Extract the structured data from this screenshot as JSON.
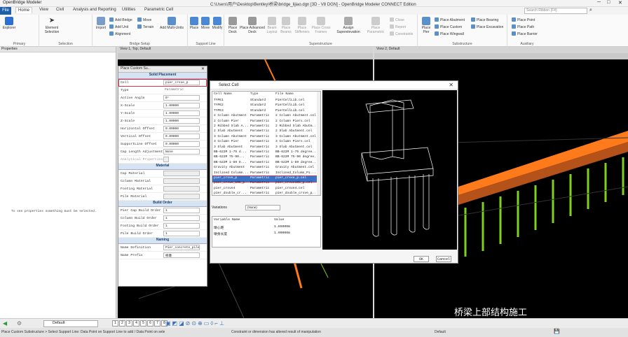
{
  "window": {
    "app_title": "OpenBridge Modeler",
    "path": "C:\\Users\\用户\\Desktop\\Bentley\\桥梁\\bridge_lijiao.dgn [3D - V8 DGN] - OpenBridge Modeler CONNECT Edition"
  },
  "tabs": [
    "File",
    "Home",
    "View",
    "Civil",
    "Analysis and Reporting",
    "Utilities",
    "Parametric Cell"
  ],
  "search_placeholder": "Search Ribbon (F4)",
  "ribbon": {
    "groups": [
      "Primary",
      "Selection",
      "Bridge Setup",
      "Support Line",
      "Superstructure",
      "Substructure",
      "Auxiliary"
    ],
    "primary": [
      "Explorer"
    ],
    "selection": [
      "Element Selection"
    ],
    "setup": [
      "Import",
      "Add Bridge",
      "Add Unit",
      "Alignment",
      "Move",
      "Terrain",
      "Add Multi-Units"
    ],
    "support": [
      "Place",
      "Move",
      "Modify"
    ],
    "super": [
      "Place Deck",
      "Place Advanced Deck",
      "Beam Layout",
      "Place Beams",
      "Place Stiffeners",
      "Place Cross Frames",
      "Assign Superelevation",
      "Place Parametric",
      "Close",
      "Report",
      "Constraints"
    ],
    "sub": [
      "Place Pier",
      "Place Abutment",
      "Place Custom",
      "Place Wingwall",
      "Place Bearing",
      "Place Excavation"
    ],
    "aux": [
      "Place Point",
      "Place Path",
      "Place Barrier"
    ]
  },
  "properties": {
    "title": "Properties",
    "message": "To see properties something must be selected."
  },
  "views": {
    "v1": "View 1, Top, Default",
    "v2": "View 2, Default"
  },
  "place_custom": {
    "title": "Place Custom Su...",
    "sections": {
      "solid": "Solid Placement",
      "material": "Material",
      "build": "Build Order",
      "naming": "Naming"
    },
    "solid_rows": [
      {
        "k": "Cell",
        "v": "pier_crsve_p"
      },
      {
        "k": "Type",
        "v": "Parametric"
      },
      {
        "k": "Active Angle",
        "v": "0°"
      },
      {
        "k": "X-Scale",
        "v": "1.00000"
      },
      {
        "k": "Y-Scale",
        "v": "1.00000"
      },
      {
        "k": "Z-Scale",
        "v": "1.00000"
      },
      {
        "k": "Horizontal Offset",
        "v": "0.00000"
      },
      {
        "k": "Vertical Offset",
        "v": "0.00000"
      },
      {
        "k": "SupportLine Offset",
        "v": "0.00000"
      },
      {
        "k": "Cap Length Adjustment",
        "v": "None"
      },
      {
        "k": "Analytical Properties",
        "v": ""
      }
    ],
    "material_rows": [
      {
        "k": "Cap Material",
        "v": ""
      },
      {
        "k": "Column Material",
        "v": ""
      },
      {
        "k": "Footing Material",
        "v": ""
      },
      {
        "k": "Pile Material",
        "v": ""
      }
    ],
    "build_rows": [
      {
        "k": "Pier Cap Build Order",
        "v": "1"
      },
      {
        "k": "Column Build Order",
        "v": "1"
      },
      {
        "k": "Footing Build Order",
        "v": "1"
      },
      {
        "k": "Pile Build Order",
        "v": "1"
      }
    ],
    "naming_rows": [
      {
        "k": "Name Definition",
        "v": "Pier_concrete_pile"
      },
      {
        "k": "Name Prefix",
        "v": "桥墩"
      }
    ]
  },
  "select_cell": {
    "title": "Select Cell",
    "headers": [
      "Cell Name",
      "Type",
      "File Name"
    ],
    "rows": [
      [
        "TYPE1",
        "Standard",
        "PierCellLib.cel"
      ],
      [
        "TYPE2",
        "Standard",
        "PierCellLib.cel"
      ],
      [
        "TYPE3",
        "Standard",
        "PierCellLib.cel"
      ],
      [
        "2 Column Abutment",
        "Parametric",
        "2 Column Abutment.cel"
      ],
      [
        "2 Column Pier",
        "Parametric",
        "2 Column Piers.cel"
      ],
      [
        "2 Ribbed Slab A...",
        "Parametric",
        "2 Ribbed Slab Abutm..."
      ],
      [
        "2 Slab Abutment",
        "Parametric",
        "2 Slab Abutment.cel"
      ],
      [
        "3 Column Abutment",
        "Parametric",
        "3 Column Abutment.cel"
      ],
      [
        "3 Column Pier",
        "Parametric",
        "3 Column Piers.cel"
      ],
      [
        "3 Slab Abutment",
        "Parametric",
        "3 Slab Abutment.cel"
      ],
      [
        "BB-622M 1-75 d...",
        "Parametric",
        "BB-622M 1-75 degree..."
      ],
      [
        "BB-622M 75-90...",
        "Parametric",
        "BB-622M 75-90 degree..."
      ],
      [
        "BB-622M 1-89 D...",
        "Parametric",
        "BB-622M 1-89 degree..."
      ],
      [
        "Gravity Abutment",
        "Parametric",
        "Gravity Abutment.cel"
      ],
      [
        "Inclined Column...",
        "Parametric",
        "Inclined_Column_Pi..."
      ],
      [
        "pier_crsve_p",
        "Parametric",
        "pier_crsve_p.cel"
      ],
      [
        "pier_crsve_105_p",
        "Parametric",
        "pier_crsve105_p.cel"
      ],
      [
        "pier_crsve4",
        "Parametric",
        "pier_crsve4.cel"
      ],
      [
        "pier_double_cr...",
        "Parametric",
        "pier_double_crsve_p..."
      ]
    ],
    "variations_label": "Variations",
    "variations_value": "(None)",
    "var_headers": [
      "Variable Name",
      "Value"
    ],
    "var_rows": [
      [
        "墩心距",
        "1.85000m"
      ],
      [
        "墩身长度",
        "1.90000m"
      ]
    ],
    "ok": "OK",
    "cancel": "Cancel"
  },
  "status": {
    "model": "Default",
    "views": [
      "1",
      "2",
      "3",
      "4",
      "5",
      "6",
      "7",
      "8"
    ],
    "prompt": "Place Custom Substructure > Select Support Line: Data Point on Support Line to add / Data Point on sele",
    "message": "Constraint or dimension has altered result of manipulation",
    "level": "Default"
  },
  "watermark": "桥梁上部结构施工",
  "colors": {
    "accent": "#1f5fa8",
    "highlight": "#e0304a",
    "deck": "#ff7a1a",
    "pier": "#7fd11c"
  }
}
